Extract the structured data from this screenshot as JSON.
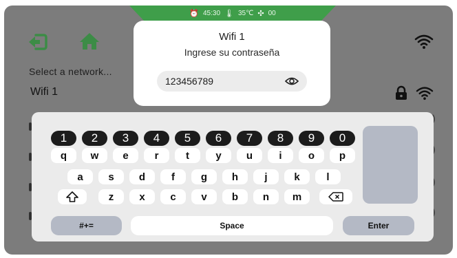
{
  "status_bar": {
    "timer_icon": "alarm-clock-icon",
    "timer": "45:30",
    "temp_icon": "thermometer-icon",
    "temperature": "35℃",
    "fan_icon": "fan-icon",
    "fan_speed": "00"
  },
  "header": {
    "back_icon": "logout-back-icon",
    "home_icon": "home-icon",
    "wifi_icon": "wifi-icon"
  },
  "networks": {
    "select_label": "Select a network...",
    "items": [
      {
        "name": "Wifi 1",
        "locked": true
      }
    ]
  },
  "dialog": {
    "title": "Wifi 1",
    "subtitle": "Ingrese su contraseña",
    "password_value": "123456789",
    "eye_icon": "eye-icon"
  },
  "keyboard": {
    "digits": [
      "1",
      "2",
      "3",
      "4",
      "5",
      "6",
      "7",
      "8",
      "9",
      "0"
    ],
    "row1": [
      "q",
      "w",
      "e",
      "r",
      "t",
      "y",
      "u",
      "i",
      "o",
      "p"
    ],
    "row2": [
      "a",
      "s",
      "d",
      "f",
      "g",
      "h",
      "j",
      "k",
      "l"
    ],
    "row3": [
      "z",
      "x",
      "c",
      "v",
      "b",
      "n",
      "m"
    ],
    "shift_icon": "shift-icon",
    "backspace_icon": "backspace-icon",
    "symbols_label": "#+=",
    "space_label": "Space",
    "enter_label": "Enter"
  },
  "colors": {
    "accent": "#3f9e4a",
    "background": "#7c7c7c",
    "key_dark": "#1c1c1c",
    "key_gray": "#b4b9c5"
  }
}
